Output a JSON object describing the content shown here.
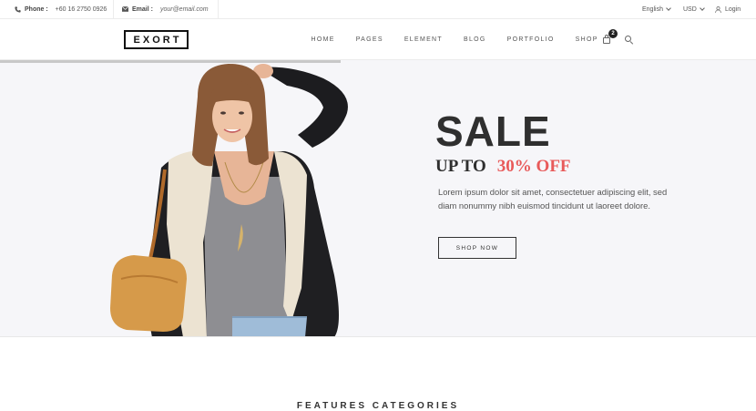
{
  "topbar": {
    "phone_label": "Phone :",
    "phone_value": "+60 16 2750 0926",
    "email_label": "Email :",
    "email_value": "your@email.com",
    "language": "English",
    "currency": "USD",
    "login": "Login"
  },
  "header": {
    "logo": "EXORT",
    "nav": [
      "HOME",
      "PAGES",
      "ELEMENT",
      "BLOG",
      "PORTFOLIO",
      "SHOP"
    ],
    "cart_count": "2",
    "icons": [
      "phone-icon",
      "envelope-icon",
      "user-icon",
      "cart-icon",
      "search-icon"
    ]
  },
  "hero": {
    "slider_progress": 0.45,
    "title": "SALE",
    "subtitle_prefix": "UP TO",
    "subtitle_highlight": "30% OFF",
    "description": "Lorem ipsum dolor sit amet, consectetuer adipiscing elit, sed diam nonummy nibh euismod tincidunt ut laoreet dolore.",
    "button": "SHOP NOW"
  },
  "section": {
    "title": "FEATURES CATEGORIES"
  },
  "colors": {
    "accent": "#e85a5a",
    "hero_bg": "#f6f6f9",
    "text_dark": "#2f2f2f"
  }
}
